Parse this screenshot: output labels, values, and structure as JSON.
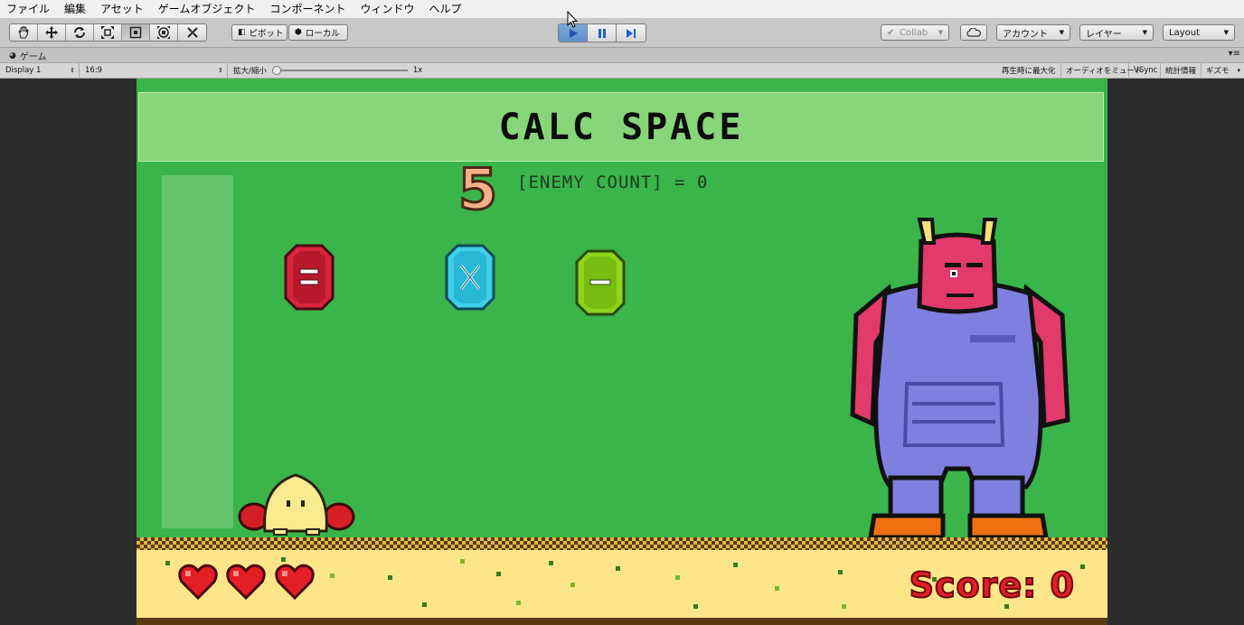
{
  "menu": [
    "ファイル",
    "編集",
    "アセット",
    "ゲームオブジェクト",
    "コンポーネント",
    "ウィンドウ",
    "ヘルプ"
  ],
  "toolbar": {
    "tools": [
      "hand-icon",
      "move-icon",
      "rotate-icon",
      "scale-icon",
      "rect-icon",
      "transform-icon",
      "custom-tool-icon"
    ],
    "pivot_label": "ピボット",
    "local_label": "ローカル",
    "collab_label": "Collab",
    "account_label": "アカウント",
    "layers_label": "レイヤー",
    "layout_label": "Layout"
  },
  "tab": {
    "title": "ゲーム"
  },
  "gamebar": {
    "display": "Display 1",
    "aspect": "16:9",
    "scale_label": "拡大/縮小",
    "scale_value": "1x",
    "maximize": "再生時に最大化",
    "mute": "オーディオをミュート",
    "vsync": "VSync",
    "stats": "統計情報",
    "gizmos": "ギズモ"
  },
  "game": {
    "title": "CALC SPACE",
    "big_number": "5",
    "enemy_count_text": "[ENEMY COUNT] = 0",
    "gems": [
      {
        "symbol": "=",
        "color": "#d9263a"
      },
      {
        "symbol": "×",
        "color": "#3fd0e8"
      },
      {
        "symbol": "−",
        "color": "#8ed41c"
      }
    ],
    "lives": 3,
    "score_text": "Score: 0",
    "colors": {
      "background": "#39b54a",
      "ground": "#fde58a",
      "score": "#e41e25"
    }
  }
}
